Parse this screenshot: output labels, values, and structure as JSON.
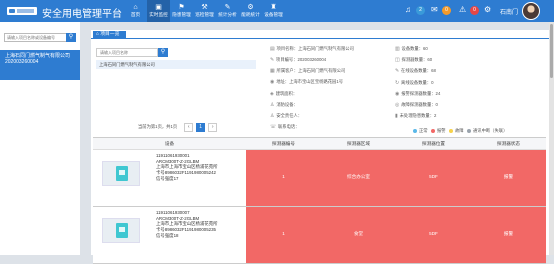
{
  "app": {
    "title": "安全用电管理平台"
  },
  "nav": [
    {
      "icon": "⌂",
      "label": "首页"
    },
    {
      "icon": "▣",
      "label": "实时监控"
    },
    {
      "icon": "⚑",
      "label": "隐患管理"
    },
    {
      "icon": "⚒",
      "label": "巡检管理"
    },
    {
      "icon": "✎",
      "label": "统计分析"
    },
    {
      "icon": "⚙",
      "label": "能耗统计"
    },
    {
      "icon": "♜",
      "label": "设备管理"
    }
  ],
  "header": {
    "badge_blue": "2",
    "badge_orange": "0",
    "badge_red": "0",
    "username": "石南门"
  },
  "sidebar": {
    "search_placeholder": "请输入项目名称或设备编号",
    "site_name": "上海石同门燃气制气有限公司",
    "site_code": "202003260004"
  },
  "tab": {
    "label": "项目一览"
  },
  "project_search": {
    "placeholder": "请输入项目名称"
  },
  "project_list": [
    "上海石同门燃气制气有限公司"
  ],
  "pager": {
    "text": "当前为第1页，共1页",
    "prev": "‹",
    "page": "1",
    "next": "›"
  },
  "project_info": [
    {
      "icon": "▤",
      "text": "项目名称：上海石同门燃气制气有限公司"
    },
    {
      "icon": "✎",
      "text": "项目编号：202003260004"
    },
    {
      "icon": "▦",
      "text": "所属客户：上海石同门燃气有限公司"
    },
    {
      "icon": "◉",
      "text": "地址：上海市宝山区宝杨路花园1号"
    },
    {
      "icon": "◈",
      "text": "建筑面积："
    },
    {
      "icon": "♙",
      "text": "消防设备："
    },
    {
      "icon": "♙",
      "text": "安全责任人："
    },
    {
      "icon": "☏",
      "text": "联系电话："
    }
  ],
  "stats": [
    {
      "icon": "▥",
      "text": "设备数量：60"
    },
    {
      "icon": "◫",
      "text": "探测器数量：60"
    },
    {
      "icon": "✎",
      "text": "在线设备数量：68"
    },
    {
      "icon": "↻",
      "text": "离线设备数量：0"
    },
    {
      "icon": "◉",
      "text": "报警探测器数量：24"
    },
    {
      "icon": "◎",
      "text": "故障探测器数量：0"
    },
    {
      "icon": "▮",
      "text": "未处理隐患数量：2"
    }
  ],
  "legend": [
    {
      "label": "正常",
      "color": "#5ab8e8"
    },
    {
      "label": "报警",
      "color": "#f26866"
    },
    {
      "label": "故障",
      "color": "#f7d24a"
    },
    {
      "label": "通讯中断（失联）",
      "color": "#9aa3ad"
    }
  ],
  "table": {
    "headers": [
      "设备",
      "探测器编号",
      "探测器区域",
      "探测器位置",
      "探测器状态"
    ],
    "rows": [
      {
        "device_lines": [
          "11911061930001",
          "ARCM300T-Z-2GLBM",
          "上海市上海市宝山区杨浦花苑所",
          "卡号8986032F11919800052​42",
          "信号强度17"
        ],
        "cells": [
          "1",
          "综合办公室",
          "5DF",
          "报警"
        ]
      },
      {
        "device_lines": [
          "11911061930007",
          "ARCM300T-Z-2GLBM",
          "上海市上海市宝山区杨浦花苑所",
          "卡号8986032F11919800052​35",
          "信号强度18"
        ],
        "cells": [
          "1",
          "食堂",
          "5DF",
          "报警"
        ]
      }
    ]
  }
}
